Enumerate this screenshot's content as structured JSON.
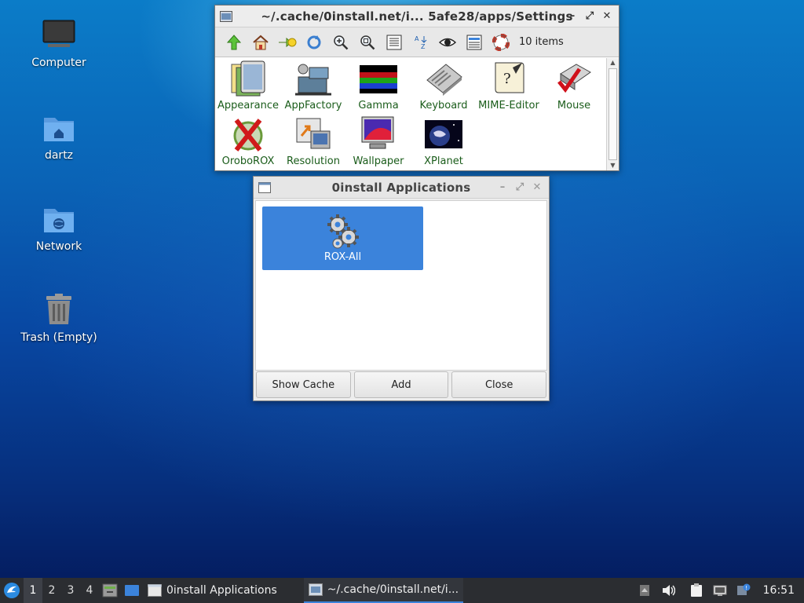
{
  "desktop": {
    "icons": [
      {
        "label": "Computer",
        "icon": "monitor-icon"
      },
      {
        "label": "dartz",
        "icon": "home-folder-icon"
      },
      {
        "label": "Network",
        "icon": "network-folder-icon"
      },
      {
        "label": "Trash (Empty)",
        "icon": "trash-icon"
      }
    ]
  },
  "filer": {
    "title": "~/.cache/0install.net/i... 5afe28/apps/Settings",
    "item_count": "10 items",
    "toolbar_icons": [
      "up-arrow-icon",
      "home-icon",
      "bookmarks-icon",
      "refresh-icon",
      "zoom-in-icon",
      "zoom-fit-icon",
      "details-view-icon",
      "sort-icon",
      "show-hidden-icon",
      "select-icon",
      "help-icon"
    ],
    "items": [
      {
        "label": "Appearance"
      },
      {
        "label": "AppFactory"
      },
      {
        "label": "Gamma"
      },
      {
        "label": "Keyboard"
      },
      {
        "label": "MIME-Editor"
      },
      {
        "label": "Mouse"
      },
      {
        "label": "OroboROX"
      },
      {
        "label": "Resolution"
      },
      {
        "label": "Wallpaper"
      },
      {
        "label": "XPlanet"
      }
    ]
  },
  "zero_install": {
    "title": "0install Applications",
    "apps": [
      {
        "label": "ROX-All"
      }
    ],
    "buttons": {
      "show_cache": "Show Cache",
      "add": "Add",
      "close": "Close"
    }
  },
  "taskbar": {
    "workspaces": [
      "1",
      "2",
      "3",
      "4"
    ],
    "active_workspace": "1",
    "tasks": [
      {
        "label": "0install Applications"
      },
      {
        "label": "~/.cache/0install.net/i..."
      }
    ],
    "clock": "16:51"
  },
  "colors": {
    "selection": "#3b83db",
    "filer_label": "#1a5c1a",
    "taskbar": "#2b2d31"
  }
}
